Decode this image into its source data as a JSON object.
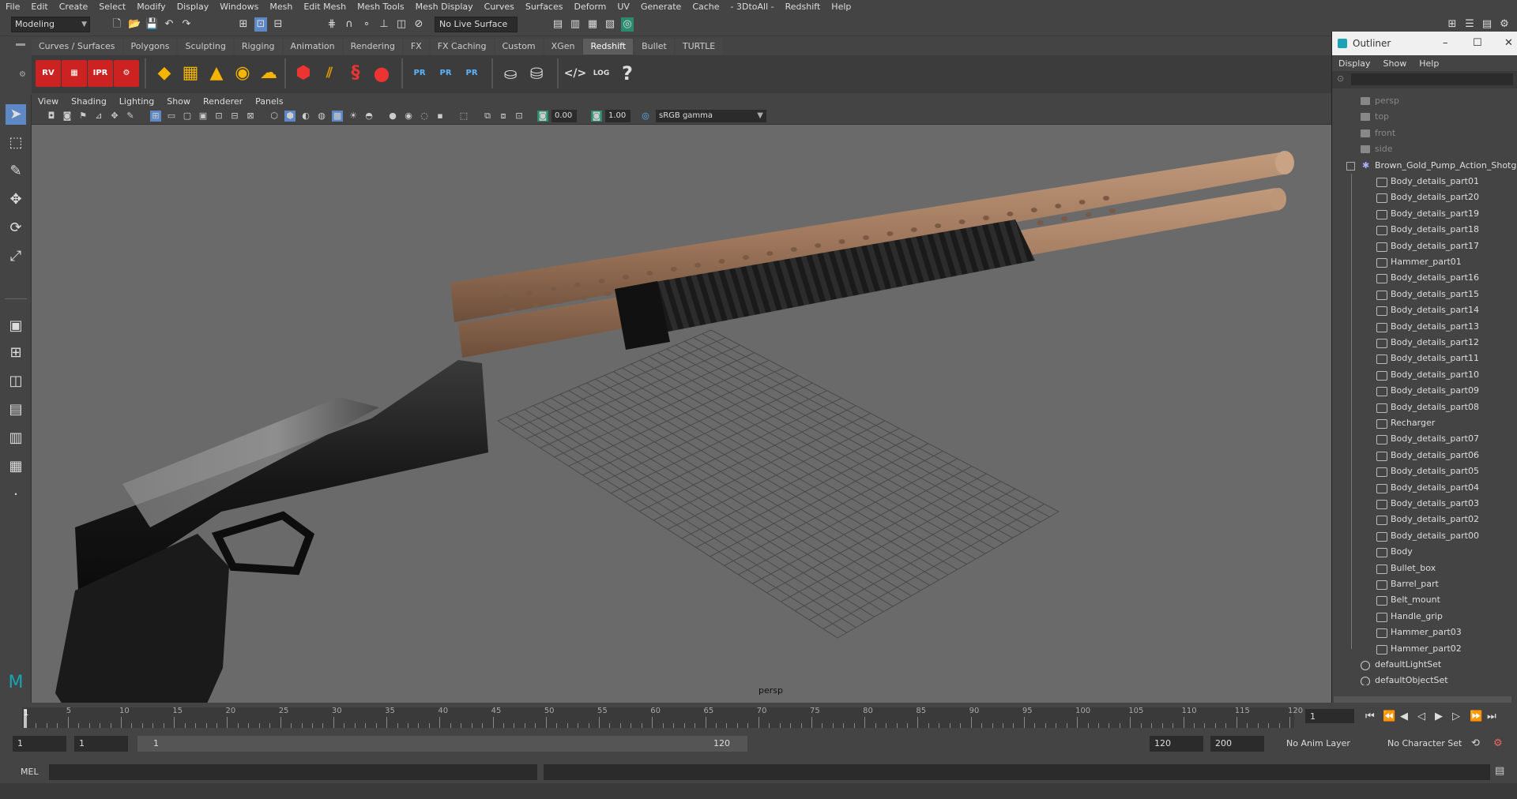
{
  "menubar": [
    "File",
    "Edit",
    "Create",
    "Select",
    "Modify",
    "Display",
    "Windows",
    "Mesh",
    "Edit Mesh",
    "Mesh Tools",
    "Mesh Display",
    "Curves",
    "Surfaces",
    "Deform",
    "UV",
    "Generate",
    "Cache",
    "- 3DtoAll -",
    "Redshift",
    "Help"
  ],
  "status": {
    "mode": "Modeling",
    "live_surface": "No Live Surface"
  },
  "shelf_tabs": [
    "Curves / Surfaces",
    "Polygons",
    "Sculpting",
    "Rigging",
    "Animation",
    "Rendering",
    "FX",
    "FX Caching",
    "Custom",
    "XGen",
    "Redshift",
    "Bullet",
    "TURTLE"
  ],
  "active_shelf_tab": "Redshift",
  "shelf_icons": {
    "rv": "RV",
    "ipr": "IPR",
    "pr": "PR",
    "log": "LOG",
    "help": "?"
  },
  "viewport": {
    "menu": [
      "View",
      "Shading",
      "Lighting",
      "Show",
      "Renderer",
      "Panels"
    ],
    "exposure": "0.00",
    "gamma_val": "1.00",
    "color_space": "sRGB gamma",
    "camera": "persp"
  },
  "outliner": {
    "title": "Outliner",
    "menu": [
      "Display",
      "Show",
      "Help"
    ],
    "cameras": [
      "persp",
      "top",
      "front",
      "side"
    ],
    "root": "Brown_Gold_Pump_Action_Shotgun",
    "children": [
      "Body_details_part01",
      "Body_details_part20",
      "Body_details_part19",
      "Body_details_part18",
      "Body_details_part17",
      "Hammer_part01",
      "Body_details_part16",
      "Body_details_part15",
      "Body_details_part14",
      "Body_details_part13",
      "Body_details_part12",
      "Body_details_part11",
      "Body_details_part10",
      "Body_details_part09",
      "Body_details_part08",
      "Recharger",
      "Body_details_part07",
      "Body_details_part06",
      "Body_details_part05",
      "Body_details_part04",
      "Body_details_part03",
      "Body_details_part02",
      "Body_details_part00",
      "Body",
      "Bullet_box",
      "Barrel_part",
      "Belt_mount",
      "Handle_grip",
      "Hammer_part03",
      "Hammer_part02"
    ],
    "sets": [
      "defaultLightSet",
      "defaultObjectSet"
    ]
  },
  "timeline": {
    "ticks": [
      "5",
      "10",
      "15",
      "20",
      "25",
      "30",
      "35",
      "40",
      "45",
      "50",
      "55",
      "60",
      "65",
      "70",
      "75",
      "80",
      "85",
      "90",
      "95",
      "100",
      "105",
      "110",
      "115",
      "120"
    ],
    "current_frame": "1",
    "current_display": "1"
  },
  "range": {
    "start": "1",
    "playback_start": "1",
    "slider_start": "1",
    "slider_end": "120",
    "playback_end": "120",
    "end": "200",
    "anim_layer": "No Anim Layer",
    "char_set": "No Character Set"
  },
  "cmdline": {
    "lang": "MEL"
  },
  "colors": {
    "wood": "#a0785d",
    "metal": "#1b1b1b",
    "accent": "#5d87c5"
  }
}
